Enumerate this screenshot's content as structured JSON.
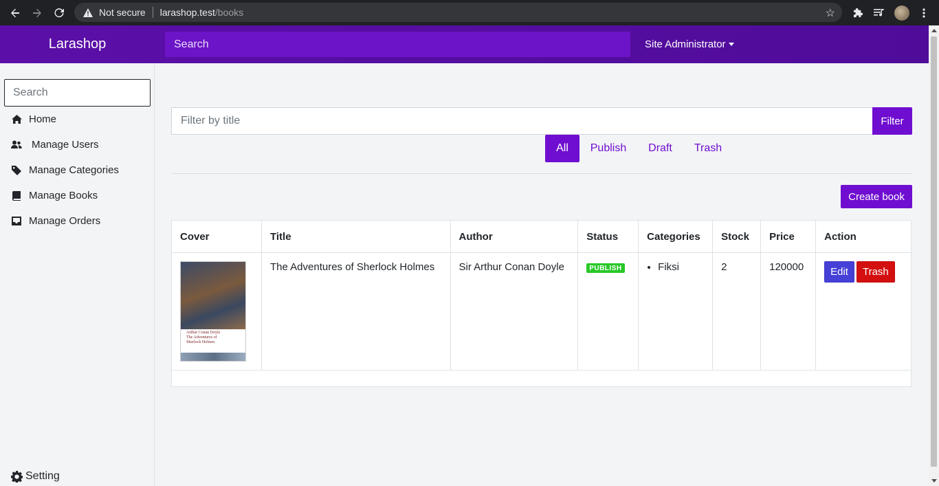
{
  "browser": {
    "security_label": "Not secure",
    "url_host": "larashop.test",
    "url_path": "/books"
  },
  "header": {
    "brand": "Larashop",
    "search_placeholder": "Search",
    "user_menu": "Site Administrator"
  },
  "sidebar": {
    "search_placeholder": "Search",
    "items": [
      {
        "label": "Home",
        "icon": "home-icon"
      },
      {
        "label": "Manage Users",
        "icon": "users-icon"
      },
      {
        "label": "Manage Categories",
        "icon": "tag-icon"
      },
      {
        "label": "Manage Books",
        "icon": "book-icon"
      },
      {
        "label": "Manage Orders",
        "icon": "inbox-icon"
      }
    ],
    "setting_label": "Setting"
  },
  "main": {
    "filter_placeholder": "Filter by title",
    "filter_button": "Filter",
    "tabs": [
      {
        "label": "All",
        "active": true
      },
      {
        "label": "Publish",
        "active": false
      },
      {
        "label": "Draft",
        "active": false
      },
      {
        "label": "Trash",
        "active": false
      }
    ],
    "create_button": "Create book",
    "table": {
      "columns": [
        "Cover",
        "Title",
        "Author",
        "Status",
        "Categories",
        "Stock",
        "Price",
        "Action"
      ],
      "rows": [
        {
          "cover_title_lines": [
            "Arthur Conan Doyle",
            "The Adventures of",
            "Sherlock Holmes"
          ],
          "title": "The Adventures of Sherlock Holmes",
          "author": "Sir Arthur Conan Doyle",
          "status": "PUBLISH",
          "categories": [
            "Fiksi"
          ],
          "stock": "2",
          "price": "120000",
          "edit_label": "Edit",
          "trash_label": "Trash"
        }
      ]
    }
  },
  "colors": {
    "primary": "#6f0ed0",
    "header": "#5b0fa8",
    "edit": "#4540d6",
    "danger": "#d40f0f",
    "success": "#28c828"
  }
}
